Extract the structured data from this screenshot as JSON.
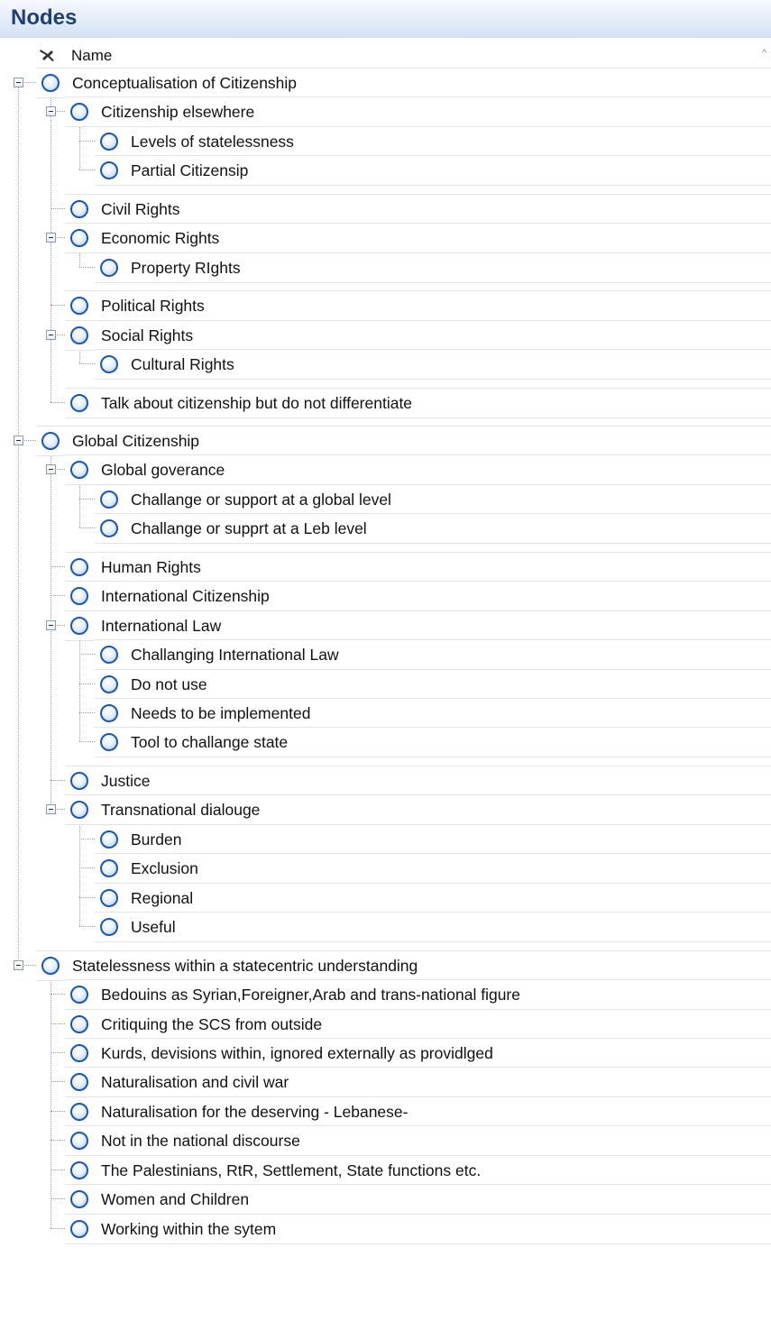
{
  "panel": {
    "title": "Nodes"
  },
  "columns": {
    "name_header": "Name"
  },
  "tree": [
    {
      "label": "Conceptualisation of Citizenship",
      "level": 0,
      "expanded": true
    },
    {
      "label": "Citizenship elsewhere",
      "level": 1,
      "expanded": true
    },
    {
      "label": "Levels of statelessness",
      "level": 2
    },
    {
      "label": "Partial Citizensip",
      "level": 2
    },
    {
      "label": "Civil Rights",
      "level": 1
    },
    {
      "label": "Economic Rights",
      "level": 1,
      "expanded": true
    },
    {
      "label": "Property RIghts",
      "level": 2
    },
    {
      "label": "Political Rights",
      "level": 1
    },
    {
      "label": "Social Rights",
      "level": 1,
      "expanded": true
    },
    {
      "label": "Cultural Rights",
      "level": 2
    },
    {
      "label": "Talk about citizenship but do not differentiate",
      "level": 1
    },
    {
      "label": "Global Citizenship",
      "level": 0,
      "expanded": true
    },
    {
      "label": "Global goverance",
      "level": 1,
      "expanded": true
    },
    {
      "label": "Challange or support at a global level",
      "level": 2
    },
    {
      "label": "Challange or supprt at a Leb level",
      "level": 2
    },
    {
      "label": "Human Rights",
      "level": 1
    },
    {
      "label": "International Citizenship",
      "level": 1
    },
    {
      "label": "International Law",
      "level": 1,
      "expanded": true
    },
    {
      "label": "Challanging International Law",
      "level": 2
    },
    {
      "label": "Do not use",
      "level": 2
    },
    {
      "label": "Needs to be implemented",
      "level": 2
    },
    {
      "label": "Tool to challange state",
      "level": 2
    },
    {
      "label": "Justice",
      "level": 1
    },
    {
      "label": "Transnational dialouge",
      "level": 1,
      "expanded": true
    },
    {
      "label": "Burden",
      "level": 2
    },
    {
      "label": "Exclusion",
      "level": 2
    },
    {
      "label": "Regional",
      "level": 2
    },
    {
      "label": "Useful",
      "level": 2
    },
    {
      "label": "Statelessness within a statecentric understanding",
      "level": 0,
      "expanded": true
    },
    {
      "label": "Bedouins as Syrian,Foreigner,Arab and trans-national figure",
      "level": 1
    },
    {
      "label": "Critiquing the SCS from outside",
      "level": 1
    },
    {
      "label": "Kurds, devisions within, ignored externally as providlged",
      "level": 1
    },
    {
      "label": "Naturalisation and civil war",
      "level": 1
    },
    {
      "label": "Naturalisation for the deserving - Lebanese-",
      "level": 1
    },
    {
      "label": "Not in the national discourse",
      "level": 1
    },
    {
      "label": "The Palestinians, RtR, Settlement, State functions etc.",
      "level": 1
    },
    {
      "label": "Women and Children",
      "level": 1
    },
    {
      "label": "Working within the sytem",
      "level": 1
    }
  ]
}
